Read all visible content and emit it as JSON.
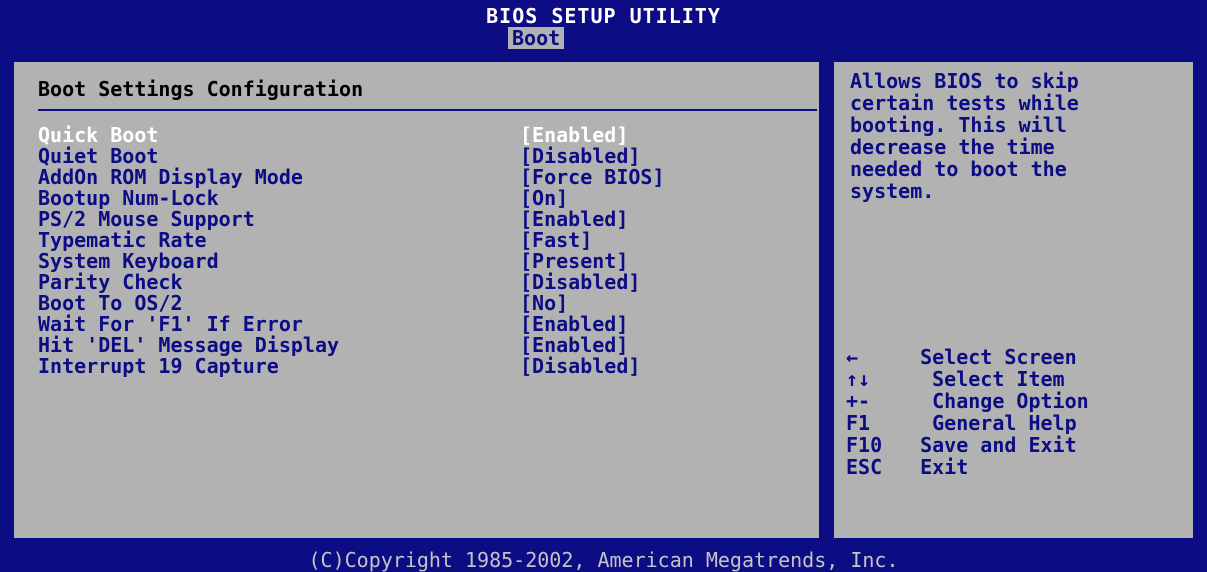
{
  "header": {
    "title": "BIOS SETUP UTILITY",
    "active_tab": "Boot"
  },
  "panel": {
    "section_title": "Boot Settings Configuration",
    "settings": [
      {
        "label": "Quick Boot",
        "value": "[Enabled]",
        "selected": true
      },
      {
        "label": "Quiet Boot",
        "value": "[Disabled]"
      },
      {
        "label": "AddOn ROM Display Mode",
        "value": "[Force BIOS]"
      },
      {
        "label": "Bootup Num-Lock",
        "value": "[On]"
      },
      {
        "label": "PS/2 Mouse Support",
        "value": "[Enabled]"
      },
      {
        "label": "Typematic Rate",
        "value": "[Fast]"
      },
      {
        "label": "System Keyboard",
        "value": "[Present]"
      },
      {
        "label": "Parity Check",
        "value": "[Disabled]"
      },
      {
        "label": "Boot To OS/2",
        "value": "[No]"
      },
      {
        "label": "Wait For 'F1' If Error",
        "value": "[Enabled]"
      },
      {
        "label": "Hit 'DEL' Message Display",
        "value": "[Enabled]"
      },
      {
        "label": "Interrupt 19 Capture",
        "value": "[Disabled]"
      }
    ]
  },
  "help": {
    "lines": [
      "Allows BIOS to skip",
      "certain tests while",
      "booting. This will",
      "decrease the time",
      "needed to boot the",
      "system."
    ]
  },
  "keys": [
    {
      "key": "←",
      "desc": "  Select Screen"
    },
    {
      "key": "↑↓",
      "desc": "   Select Item"
    },
    {
      "key": "+-",
      "desc": "   Change Option"
    },
    {
      "key": "F1",
      "desc": "   General Help"
    },
    {
      "key": "F10",
      "desc": "  Save and Exit"
    },
    {
      "key": "ESC",
      "desc": "  Exit"
    }
  ],
  "footer": {
    "text": "(C)Copyright 1985-2002, American Megatrends, Inc."
  },
  "colors": {
    "bios_blue": "#0c0c84",
    "panel_gray": "#b2b2b2",
    "highlight_white": "#ffffff"
  }
}
